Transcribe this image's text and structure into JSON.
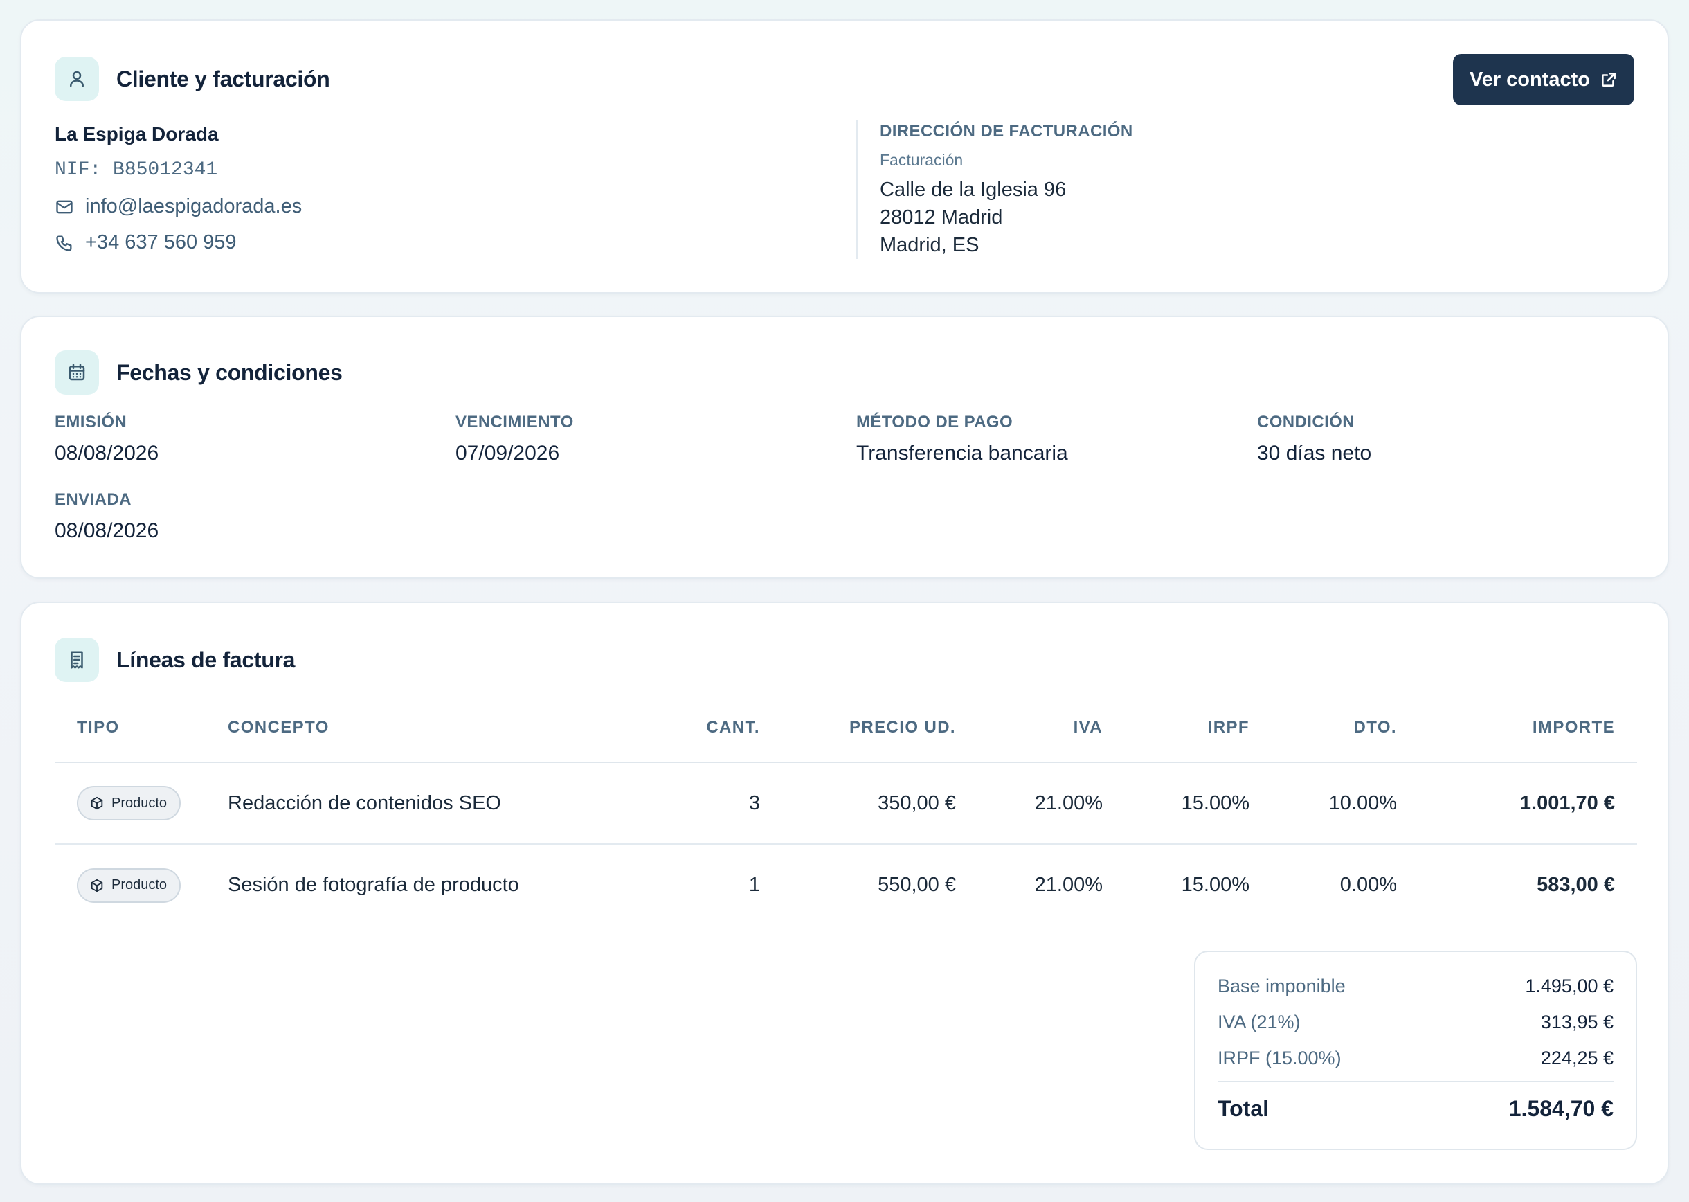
{
  "client_card": {
    "title": "Cliente y facturación",
    "contact_button": "Ver contacto",
    "name": "La Espiga Dorada",
    "nif": "NIF: B85012341",
    "email": "info@laespigadorada.es",
    "phone": "+34 637 560 959",
    "address": {
      "title": "DIRECCIÓN DE FACTURACIÓN",
      "subtitle": "Facturación",
      "line1": "Calle de la Iglesia 96",
      "line2": "28012 Madrid",
      "line3": "Madrid, ES"
    }
  },
  "dates_card": {
    "title": "Fechas y condiciones",
    "issue": {
      "label": "EMISIÓN",
      "value": "08/08/2026"
    },
    "due": {
      "label": "VENCIMIENTO",
      "value": "07/09/2026"
    },
    "payment": {
      "label": "MÉTODO DE PAGO",
      "value": "Transferencia bancaria"
    },
    "terms": {
      "label": "CONDICIÓN",
      "value": "30 días neto"
    },
    "sent": {
      "label": "ENVIADA",
      "value": "08/08/2026"
    }
  },
  "lines_card": {
    "title": "Líneas de factura",
    "columns": {
      "type": "TIPO",
      "concept": "CONCEPTO",
      "qty": "CANT.",
      "unit_price": "PRECIO UD.",
      "vat": "IVA",
      "irpf": "IRPF",
      "discount": "DTO.",
      "amount": "IMPORTE"
    },
    "rows": [
      {
        "type": "Producto",
        "concept": "Redacción de contenidos SEO",
        "qty": "3",
        "unit_price": "350,00 €",
        "vat": "21.00%",
        "irpf": "15.00%",
        "discount": "10.00%",
        "amount": "1.001,70 €"
      },
      {
        "type": "Producto",
        "concept": "Sesión de fotografía de producto",
        "qty": "1",
        "unit_price": "550,00 €",
        "vat": "21.00%",
        "irpf": "15.00%",
        "discount": "0.00%",
        "amount": "583,00 €"
      }
    ],
    "totals": {
      "base_label": "Base imponible",
      "base_value": "1.495,00 €",
      "vat_label": "IVA (21%)",
      "vat_value": "313,95 €",
      "irpf_label": "IRPF (15.00%)",
      "irpf_value": "224,25 €",
      "total_label": "Total",
      "total_value": "1.584,70 €"
    }
  },
  "icons": {
    "client": "user-icon",
    "dates": "calendar-icon",
    "lines": "receipt-icon",
    "contact": "external-link-icon",
    "email": "mail-icon",
    "phone": "phone-icon",
    "product": "package-icon"
  },
  "colors": {
    "primary_button": "#1e344e",
    "icon_bg": "#dff3f3",
    "label": "#4d6a82"
  }
}
